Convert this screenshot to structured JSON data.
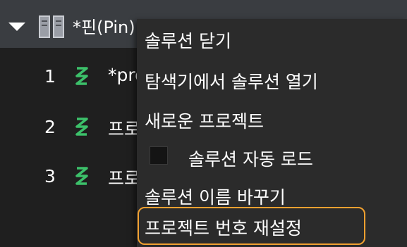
{
  "solution": {
    "title": "*핀(Pin) 인쇄 출력",
    "projects": [
      {
        "number": "1",
        "name": "*project"
      },
      {
        "number": "2",
        "name": "프로젝트"
      },
      {
        "number": "3",
        "name": "프로젝트"
      }
    ]
  },
  "context_menu": {
    "items": [
      {
        "label": "솔루션 닫기"
      },
      {
        "label": "탐색기에서 솔루션 열기"
      },
      {
        "label": "새로운 프로젝트"
      },
      {
        "label": "솔루션 자동 로드",
        "checked": false
      },
      {
        "label": "솔루션 이름 바꾸기"
      },
      {
        "label": "프로젝트 번호 재설정"
      }
    ]
  },
  "colors": {
    "highlight_outline": "#f0a030",
    "project_icon": "#3cc06a",
    "menu_background": "#2b2b2b",
    "header_background": "#3a3d41"
  }
}
